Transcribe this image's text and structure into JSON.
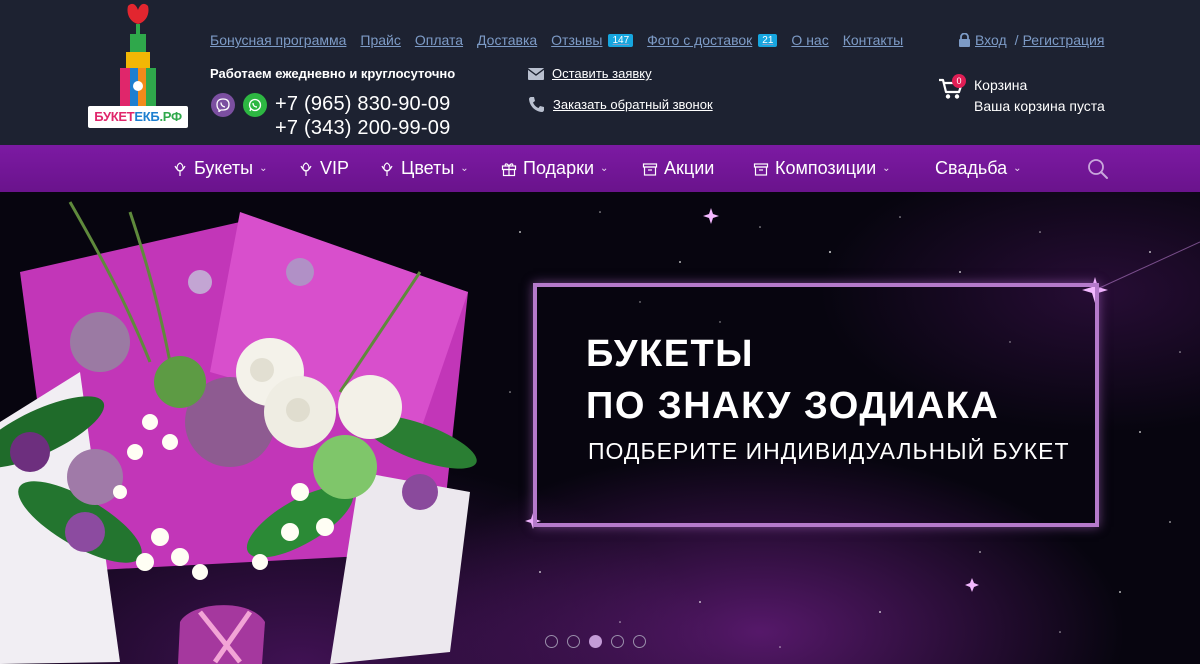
{
  "logo": {
    "part1": "БУКЕТ",
    "part2": "ЕКБ",
    "part3": ".РФ"
  },
  "topnav": [
    {
      "label": "Бонусная программа"
    },
    {
      "label": "Прайс"
    },
    {
      "label": "Оплата"
    },
    {
      "label": "Доставка"
    },
    {
      "label": "Отзывы",
      "badge": "147"
    },
    {
      "label": "Фото с доставок",
      "badge": "21"
    },
    {
      "label": "О нас"
    },
    {
      "label": "Контакты"
    }
  ],
  "auth": {
    "login": "Вход",
    "separator": "/",
    "register": "Регистрация"
  },
  "contacts": {
    "worktime": "Работаем ежедневно и круглосуточно",
    "phone1": "+7 (965) 830-90-09",
    "phone2": "+7 (343) 200-99-09",
    "leave_request": "Оставить заявку",
    "callback": "Заказать обратный звонок"
  },
  "cart": {
    "count": "0",
    "title": "Корзина",
    "status": "Ваша корзина пуста"
  },
  "menu": [
    {
      "label": "Букеты",
      "icon": "flower-icon",
      "dropdown": true
    },
    {
      "label": "VIP",
      "icon": "flower-icon",
      "dropdown": false
    },
    {
      "label": "Цветы",
      "icon": "flower-icon",
      "dropdown": true
    },
    {
      "label": "Подарки",
      "icon": "gift-icon",
      "dropdown": true
    },
    {
      "label": "Акции",
      "icon": "box-icon",
      "dropdown": false
    },
    {
      "label": "Композиции",
      "icon": "box-icon",
      "dropdown": true
    },
    {
      "label": "Свадьба",
      "icon": "",
      "dropdown": true
    }
  ],
  "hero": {
    "title_line1": "БУКЕТЫ",
    "title_line2": "ПО ЗНАКУ ЗОДИАКА",
    "subtitle": "ПОДБЕРИТЕ ИНДИВИДУАЛЬНЫЙ БУКЕТ",
    "slides_total": 5,
    "active_slide": 3
  },
  "colors": {
    "header_bg": "#1d2231",
    "menu_bg": "#7c1aa3",
    "link": "#7d9bc6",
    "badge": "#16a6df",
    "frame": "#b57acb"
  }
}
